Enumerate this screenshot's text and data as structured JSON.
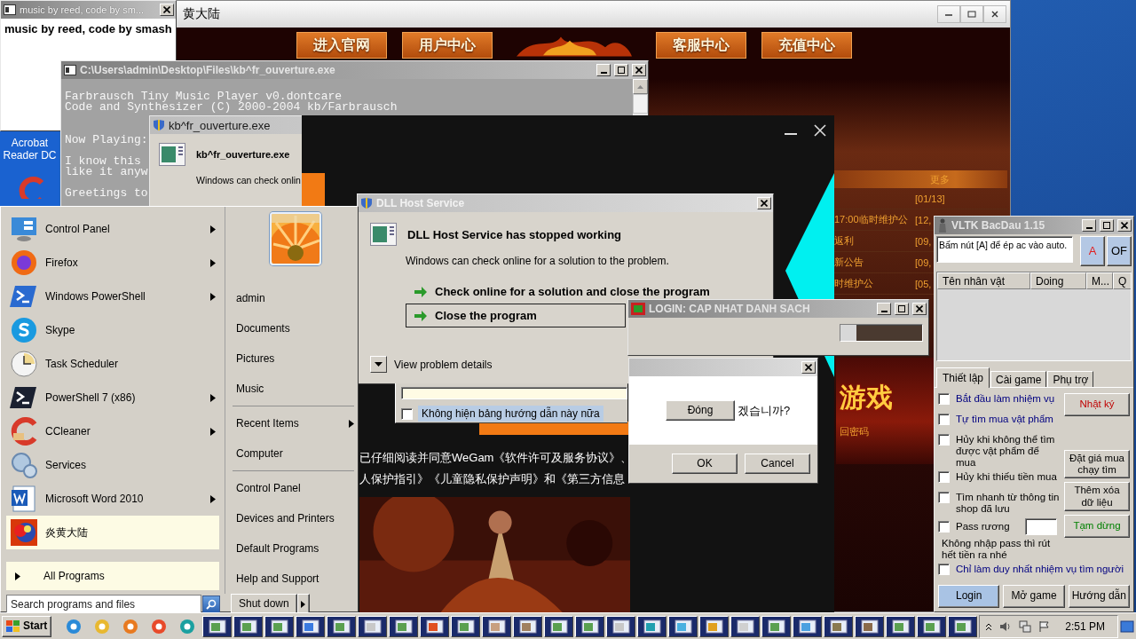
{
  "desktop": {
    "icons": [
      {
        "label": "Acrobat Reader DC"
      }
    ]
  },
  "game_window": {
    "title": "黄大陆",
    "nav": [
      {
        "label": "进入官网"
      },
      {
        "label": "用户中心"
      },
      {
        "label": "客服中心"
      },
      {
        "label": "充值中心"
      }
    ],
    "news": {
      "more": "更多",
      "rows": [
        {
          "date": "[01/13]"
        },
        {
          "title": "17:00临时维护公",
          "date": "[12,"
        },
        {
          "title": "返利",
          "date": "[09,"
        },
        {
          "title": "新公告",
          "date": "[09,"
        },
        {
          "title": "时维护公",
          "date": "[05,"
        }
      ]
    },
    "banner": {
      "heading": "游戏",
      "link": "回密码"
    }
  },
  "music_window": {
    "title": "music by reed, code by sm...",
    "text": "music by reed, code by smash"
  },
  "console_window": {
    "title": "C:\\Users\\admin\\Desktop\\Files\\kb^fr_ouverture.exe",
    "paragraphs": [
      [
        "Farbrausch Tiny Music Player v0.dontcare",
        "Code and Synthesizer (C) 2000-2004 kb/Farbrausch"
      ],
      [
        "Now Playing:"
      ],
      [
        "I know this",
        "like it anyw"
      ],
      [
        "Greetings to"
      ]
    ]
  },
  "crash_dialog_back": {
    "title": "kb^fr_ouverture.exe",
    "heading": "kb^fr_ouverture.exe",
    "text": "Windows can check onlin"
  },
  "launcher_window": {
    "agreement": [
      "已仔细阅读并同意WeGam《软件许可及服务协议》、",
      "人保护指引》《儿童隐私保护声明》和《第三方信息"
    ]
  },
  "crash_dialog": {
    "title": "DLL Host Service",
    "heading": "DLL Host Service has stopped working",
    "text": "Windows can check online for a solution to the problem.",
    "options": [
      {
        "label": "Check online for a solution and close the program",
        "selected": false
      },
      {
        "label": "Close the program",
        "selected": true
      }
    ],
    "details": "View problem details"
  },
  "login_window": {
    "title": "LOGIN: CAP NHAT DANH SACH",
    "level": 0.2
  },
  "confirm_dialog": {
    "text": "겠습니까?",
    "buttons": [
      "OK",
      "Cancel"
    ]
  },
  "guide_dialog": {
    "checkbox": {
      "label": "Không hiện bảng hướng dẫn này nữa",
      "checked": false
    },
    "button": "Đóng"
  },
  "bot_window": {
    "title": "VLTK BacDau 1.15",
    "info": "Bấm nút [A] để ép ac vào auto.",
    "top_buttons": [
      {
        "label": "A",
        "color": "#e02020"
      },
      {
        "label": "OF",
        "color": "#000000"
      }
    ],
    "columns": [
      "Tên nhân vật",
      "Doing",
      "M...",
      "Q"
    ],
    "tabs": [
      {
        "label": "Thiết lập",
        "selected": true
      },
      {
        "label": "Cài game",
        "selected": false
      },
      {
        "label": "Phụ trợ",
        "selected": false
      }
    ],
    "options": [
      {
        "kind": "check",
        "label": "Bắt đầu làm nhiệm vụ",
        "checked": false,
        "color": "#000080"
      },
      {
        "kind": "check",
        "label": "Tự tìm mua vật phẩm",
        "checked": false,
        "color": "#000080"
      },
      {
        "kind": "check",
        "label": "Hủy khi không thể tìm được vật phẩm để mua",
        "checked": false,
        "color": "#000000"
      },
      {
        "kind": "check",
        "label": "Hủy khi thiếu tiền mua",
        "checked": false,
        "color": "#000000"
      },
      {
        "kind": "check",
        "label": "Tìm nhanh từ thông tin shop đã lưu",
        "checked": false,
        "color": "#000000"
      },
      {
        "kind": "field",
        "label": "Pass rương",
        "checked": false,
        "color": "#000000"
      },
      {
        "kind": "note",
        "label": "Không nhập pass thì rút hết tiền ra nhé",
        "color": "#000000"
      },
      {
        "kind": "check",
        "label": "Chỉ làm duy nhất nhiệm vụ tìm người",
        "checked": false,
        "color": "#000080"
      }
    ],
    "side_buttons": [
      {
        "label": "Nhật ký",
        "color": "#c00000"
      },
      {
        "label": "Đặt giá mua chạy tìm",
        "color": "#000000"
      },
      {
        "label": "Thêm xóa dữ liệu",
        "color": "#000000"
      },
      {
        "label": "Tạm dừng",
        "color": "#008000"
      }
    ],
    "bottom_buttons": [
      {
        "label": "Login",
        "selected": true
      },
      {
        "label": "Mở game",
        "selected": false
      },
      {
        "label": "Hướng dẫn",
        "selected": false
      }
    ]
  },
  "start_menu": {
    "programs": [
      {
        "label": "Control Panel",
        "submenu": true,
        "selected": false
      },
      {
        "label": "Firefox",
        "submenu": true,
        "selected": false
      },
      {
        "label": "Windows PowerShell",
        "submenu": true,
        "selected": false
      },
      {
        "label": "Skype",
        "submenu": false,
        "selected": false
      },
      {
        "label": "Task Scheduler",
        "submenu": false,
        "selected": false
      },
      {
        "label": "PowerShell 7 (x86)",
        "submenu": true,
        "selected": false
      },
      {
        "label": "CCleaner",
        "submenu": true,
        "selected": false
      },
      {
        "label": "Services",
        "submenu": false,
        "selected": false
      },
      {
        "label": "Microsoft Word 2010",
        "submenu": true,
        "selected": false
      },
      {
        "label": "炎黄大陆",
        "submenu": false,
        "selected": true
      }
    ],
    "all_programs": "All Programs",
    "search": {
      "placeholder": "Search programs and files"
    },
    "places": [
      [
        {
          "label": "admin",
          "submenu": false
        },
        {
          "label": "Documents",
          "submenu": false
        },
        {
          "label": "Pictures",
          "submenu": false
        },
        {
          "label": "Music",
          "submenu": false
        }
      ],
      [
        {
          "label": "Recent Items",
          "submenu": true
        },
        {
          "label": "Computer",
          "submenu": false
        }
      ],
      [
        {
          "label": "Control Panel",
          "submenu": false
        },
        {
          "label": "Devices and Printers",
          "submenu": false
        },
        {
          "label": "Default Programs",
          "submenu": false
        },
        {
          "label": "Help and Support",
          "submenu": false
        }
      ]
    ],
    "shutdown": "Shut down"
  },
  "taskbar": {
    "start": "Start",
    "clock": "2:51 PM"
  }
}
